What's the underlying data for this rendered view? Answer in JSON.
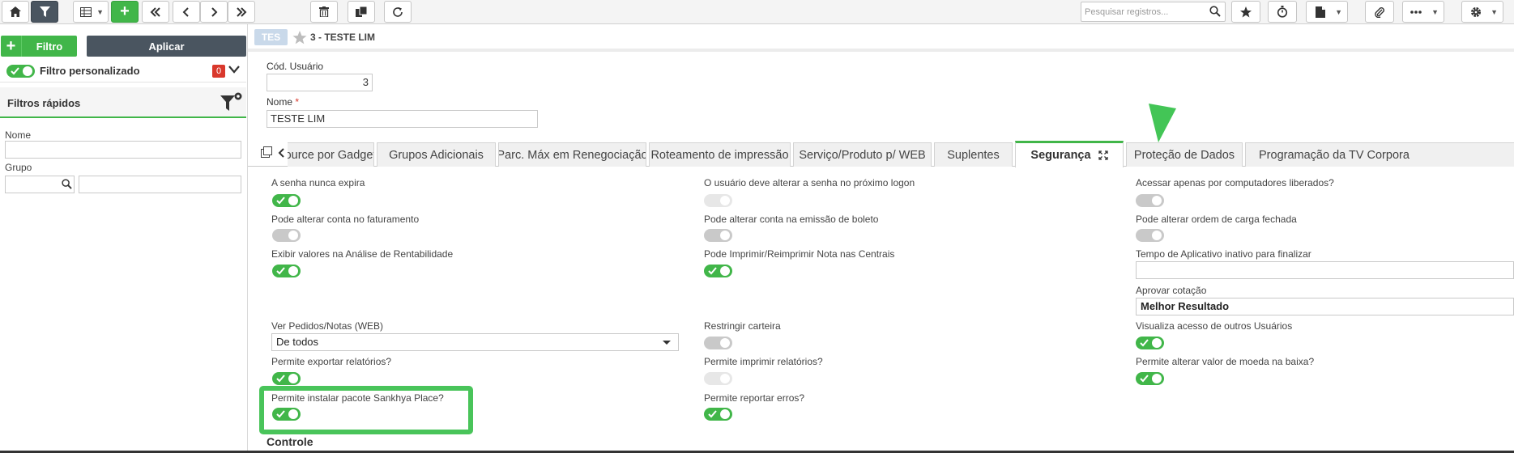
{
  "toolbar": {
    "search_placeholder": "Pesquisar registros...",
    "plus_label": "+"
  },
  "filters": {
    "filtro_button": "Filtro",
    "aplicar_button": "Aplicar",
    "custom_filter_label": "Filtro personalizado",
    "custom_filter_count": "0",
    "quick_filters_title": "Filtros rápidos",
    "nome_label": "Nome",
    "grupo_label": "Grupo"
  },
  "record": {
    "badge": "TES",
    "title": "3 - TESTE LIM",
    "cod_usuario_label": "Cód. Usuário",
    "cod_usuario_value": "3",
    "nome_label": "Nome",
    "nome_required": "*",
    "nome_value": "TESTE LIM"
  },
  "tabs": [
    {
      "label": "ource por Gadget",
      "active": false
    },
    {
      "label": "Grupos Adicionais",
      "active": false
    },
    {
      "label": "Parc. Máx em Renegociação",
      "active": false
    },
    {
      "label": "Roteamento de impressão",
      "active": false
    },
    {
      "label": "Serviço/Produto p/ WEB",
      "active": false
    },
    {
      "label": "Suplentes",
      "active": false
    },
    {
      "label": "Segurança",
      "active": true
    },
    {
      "label": "Proteção de Dados",
      "active": false
    },
    {
      "label": "Programação da TV Corpora",
      "active": false
    }
  ],
  "security": {
    "col1": [
      {
        "label": "A senha nunca expira",
        "state": "on"
      },
      {
        "label": "Pode alterar conta no faturamento",
        "state": "off"
      },
      {
        "label": "Exibir valores na Análise de Rentabilidade",
        "state": "on"
      },
      {
        "label": "Ver Pedidos/Notas (WEB)",
        "select": "De todos"
      },
      {
        "label": "Permite exportar relatórios?",
        "state": "on"
      },
      {
        "label": "Permite instalar pacote Sankhya Place?",
        "state": "on"
      }
    ],
    "col2": [
      {
        "label": "O usuário deve alterar a senha no próximo logon",
        "state": "disabled"
      },
      {
        "label": "Pode alterar conta na emissão de boleto",
        "state": "off"
      },
      {
        "label": "Pode Imprimir/Reimprimir Nota nas Centrais",
        "state": "on"
      },
      {
        "label": "Restringir carteira",
        "state": "off"
      },
      {
        "label": "Permite imprimir relatórios?",
        "state": "disabled"
      },
      {
        "label": "Permite reportar erros?",
        "state": "on"
      }
    ],
    "col3": [
      {
        "label": "Acessar apenas por computadores liberados?",
        "state": "off"
      },
      {
        "label": "Pode alterar ordem de carga fechada",
        "state": "off"
      },
      {
        "label": "Tempo de Aplicativo inativo para finalizar",
        "input": ""
      },
      {
        "label": "Aprovar cotação",
        "select": "Melhor Resultado"
      },
      {
        "label": "Visualiza acesso de outros Usuários",
        "state": "on"
      },
      {
        "label": "Permite alterar valor de moeda na baixa?",
        "state": "on"
      }
    ],
    "controle_title": "Controle"
  },
  "colors": {
    "accent_green": "#41b649",
    "toolbar_dark": "#4a5560",
    "badge_red": "#d9382c"
  }
}
